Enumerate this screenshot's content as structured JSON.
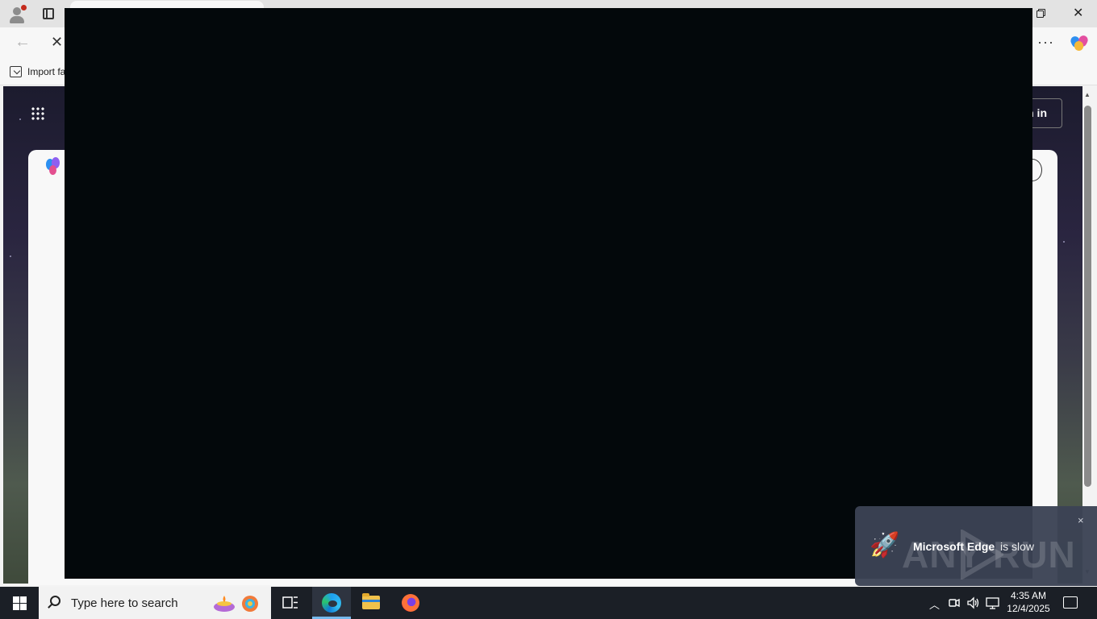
{
  "browser": {
    "back_glyph": "←",
    "stop_glyph": "✕",
    "more_glyph": "···",
    "close_glyph": "✕"
  },
  "favorites_bar": {
    "import_label": "Import fa"
  },
  "page": {
    "signin_label": "n in"
  },
  "toast": {
    "title": "Microsoft Edge",
    "message": "is slow",
    "close_glyph": "×",
    "watermark": "ANY   RUN"
  },
  "taskbar": {
    "search_placeholder": "Type here to search",
    "time": "4:35 AM",
    "date": "12/4/2025"
  },
  "icons": [
    "profile-icon",
    "tabs-icon",
    "restore-icon",
    "close-icon",
    "back-icon",
    "stop-icon",
    "more-icon",
    "copilot-icon",
    "import-icon",
    "apps-grid-icon",
    "scroll-up-icon",
    "scroll-down-icon",
    "rocket-icon",
    "windows-start-icon",
    "search-icon",
    "diya-icon",
    "task-view-icon",
    "edge-icon",
    "file-explorer-icon",
    "firefox-icon",
    "chevron-up-icon",
    "meet-now-icon",
    "volume-icon",
    "network-icon",
    "notification-icon"
  ]
}
